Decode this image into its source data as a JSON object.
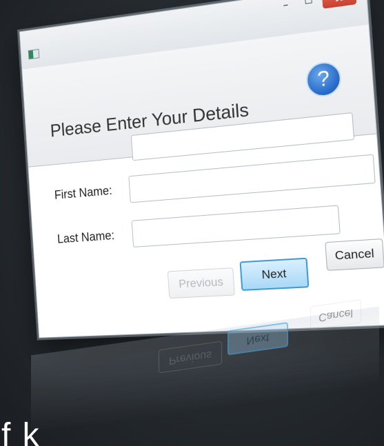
{
  "window": {
    "controls": {
      "minimize": "–",
      "maximize": "☐",
      "close": "x"
    },
    "icon": "app-icon",
    "help_icon_glyph": "?"
  },
  "header": {
    "title": "Please Enter Your Details"
  },
  "form": {
    "first_name_label": "First Name:",
    "first_name_value": "",
    "last_name_label": "Last Name:",
    "last_name_value": ""
  },
  "buttons": {
    "previous": "Previous",
    "next": "Next",
    "cancel": "Cancel"
  },
  "bottom_caption": "f              k"
}
